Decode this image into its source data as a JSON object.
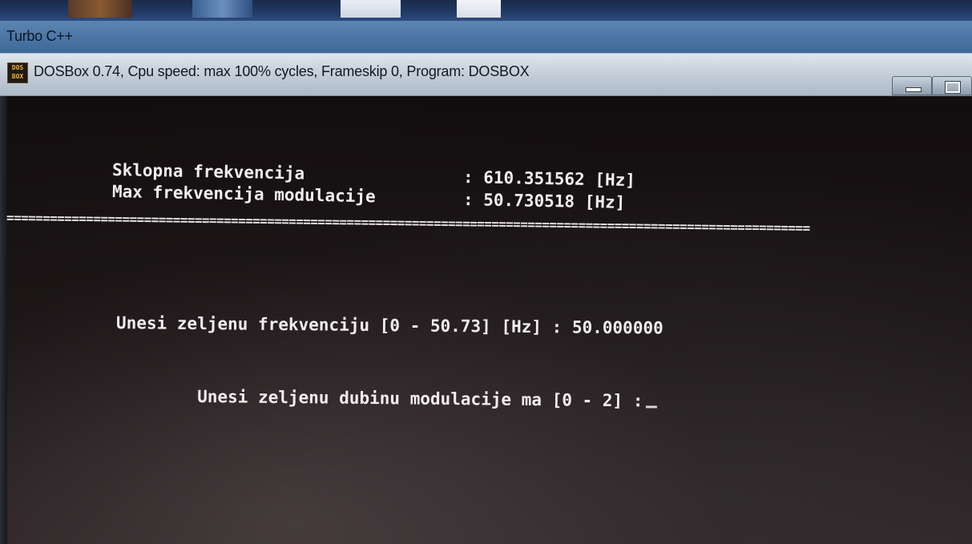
{
  "back_window": {
    "title": "Turbo C++"
  },
  "dosbox": {
    "icon_text": "DOS BOX",
    "title": "DOSBox 0.74, Cpu speed: max 100% cycles, Frameskip  0, Program:   DOSBOX"
  },
  "console": {
    "line1_label": "Sklopna frekvencija",
    "line1_value": ": 610.351562 [Hz]",
    "line2_label": "Max frekvencija modulacije",
    "line2_value": ": 50.730518 [Hz]",
    "separator": "===============================================================================================================",
    "prompt_frequency": "Unesi zeljenu frekvenciju [0 - 50.73] [Hz] : 50.000000",
    "prompt_depth": "Unesi zeljenu dubinu modulacije ma [0 - 2] :"
  }
}
